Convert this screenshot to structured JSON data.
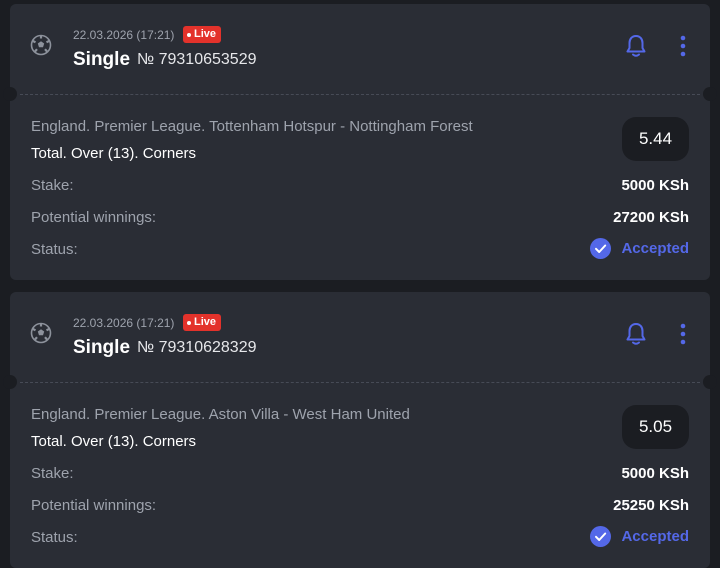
{
  "colors": {
    "background": "#1b1d22",
    "card": "#2a2d35",
    "accent": "#5468e8",
    "live": "#e3322b",
    "muted_text": "#9ea3ad"
  },
  "bets": [
    {
      "date": "22.03.2026 (17:21)",
      "live_label": "Live",
      "type": "Single",
      "number": "№ 79310653529",
      "event": "England. Premier League. Tottenham Hotspur - Nottingham Forest",
      "market": "Total. Over (13). Corners",
      "odds": "5.44",
      "stake_label": "Stake:",
      "stake_value": "5000 KSh",
      "winnings_label": "Potential winnings:",
      "winnings_value": "27200 KSh",
      "status_label": "Status:",
      "status_value": "Accepted",
      "sport_icon": "soccer-ball-icon",
      "notify_icon": "bell-icon",
      "menu_icon": "more-vertical-icon"
    },
    {
      "date": "22.03.2026 (17:21)",
      "live_label": "Live",
      "type": "Single",
      "number": "№ 79310628329",
      "event": "England. Premier League. Aston Villa - West Ham United",
      "market": "Total. Over (13). Corners",
      "odds": "5.05",
      "stake_label": "Stake:",
      "stake_value": "5000 KSh",
      "winnings_label": "Potential winnings:",
      "winnings_value": "25250 KSh",
      "status_label": "Status:",
      "status_value": "Accepted",
      "sport_icon": "soccer-ball-icon",
      "notify_icon": "bell-icon",
      "menu_icon": "more-vertical-icon"
    }
  ]
}
